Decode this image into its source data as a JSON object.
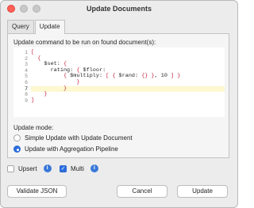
{
  "window": {
    "title": "Update Documents"
  },
  "tabs": [
    {
      "label": "Query",
      "active": false
    },
    {
      "label": "Update",
      "active": true
    }
  ],
  "update": {
    "command_label": "Update command to be run on found document(s):",
    "line_numbers": [
      "1",
      "2",
      "3",
      "4",
      "5",
      "6",
      "7",
      "8",
      "9"
    ],
    "code_lines": [
      "[",
      "  {",
      "    $set: {",
      "      rating: { $floor:",
      "          { $multiply: [ { $rand: {} }, 10 ] }",
      "              }",
      "          }",
      "    }",
      "]"
    ],
    "highlighted_line": 7,
    "mode_label": "Update mode:",
    "modes": [
      {
        "label": "Simple Update with Update Document",
        "selected": false
      },
      {
        "label": "Update with Aggregation Pipeline",
        "selected": true
      }
    ]
  },
  "options": {
    "upsert": {
      "label": "Upsert",
      "checked": false,
      "info": "i"
    },
    "multi": {
      "label": "Multi",
      "checked": true,
      "info": "i"
    }
  },
  "buttons": {
    "validate": "Validate JSON",
    "cancel": "Cancel",
    "update": "Update"
  },
  "colors": {
    "accent": "#2d6fe0",
    "bracket": "#c0203a",
    "line_highlight": "#fdf8cf",
    "close_button": "#ff5f57"
  }
}
